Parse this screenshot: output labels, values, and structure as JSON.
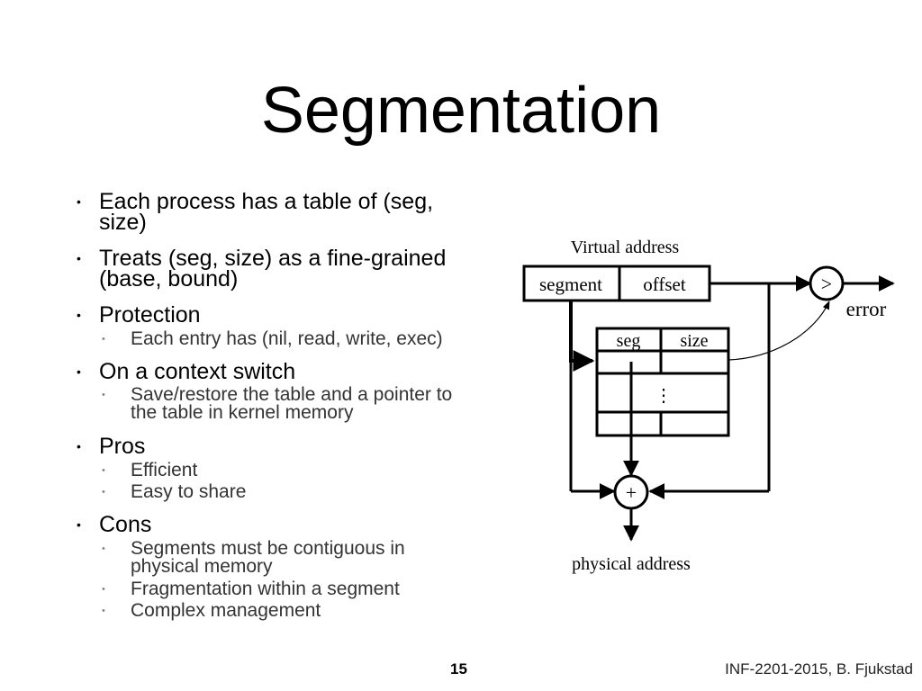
{
  "title": "Segmentation",
  "bullets": [
    {
      "text_lines": [
        "Each process has a table of (seg,",
        "size)"
      ]
    },
    {
      "text_lines": [
        "Treats (seg, size) as a fine-grained",
        "(base, bound)"
      ]
    },
    {
      "text": "Protection",
      "sub": [
        {
          "text_lines": [
            "Each entry has (nil, read, write, exec)"
          ]
        }
      ]
    },
    {
      "text": "On a context switch",
      "sub": [
        {
          "text_lines": [
            "Save/restore the table and a pointer to",
            "the table in kernel memory"
          ]
        }
      ]
    },
    {
      "text": "Pros",
      "sub": [
        {
          "text_lines": [
            "Efficient"
          ]
        },
        {
          "text_lines": [
            "Easy to share"
          ]
        }
      ]
    },
    {
      "text": "Cons",
      "sub": [
        {
          "text_lines": [
            "Segments must be contiguous in",
            "physical memory"
          ]
        },
        {
          "text_lines": [
            "Fragmentation within a segment"
          ]
        },
        {
          "text_lines": [
            "Complex management"
          ]
        }
      ]
    }
  ],
  "bullet_glyph": "•",
  "diagram": {
    "virtual_address_label": "Virtual address",
    "segment_label": "segment",
    "offset_label": "offset",
    "compare_op": ">",
    "error_label": "error",
    "table_col_seg": "seg",
    "table_col_size": "size",
    "ellipsis": "⋮",
    "add_op": "+",
    "physical_address_label": "physical address"
  },
  "footer": {
    "page_number": "15",
    "course": "INF-2201-2015, B. Fjukstad"
  }
}
